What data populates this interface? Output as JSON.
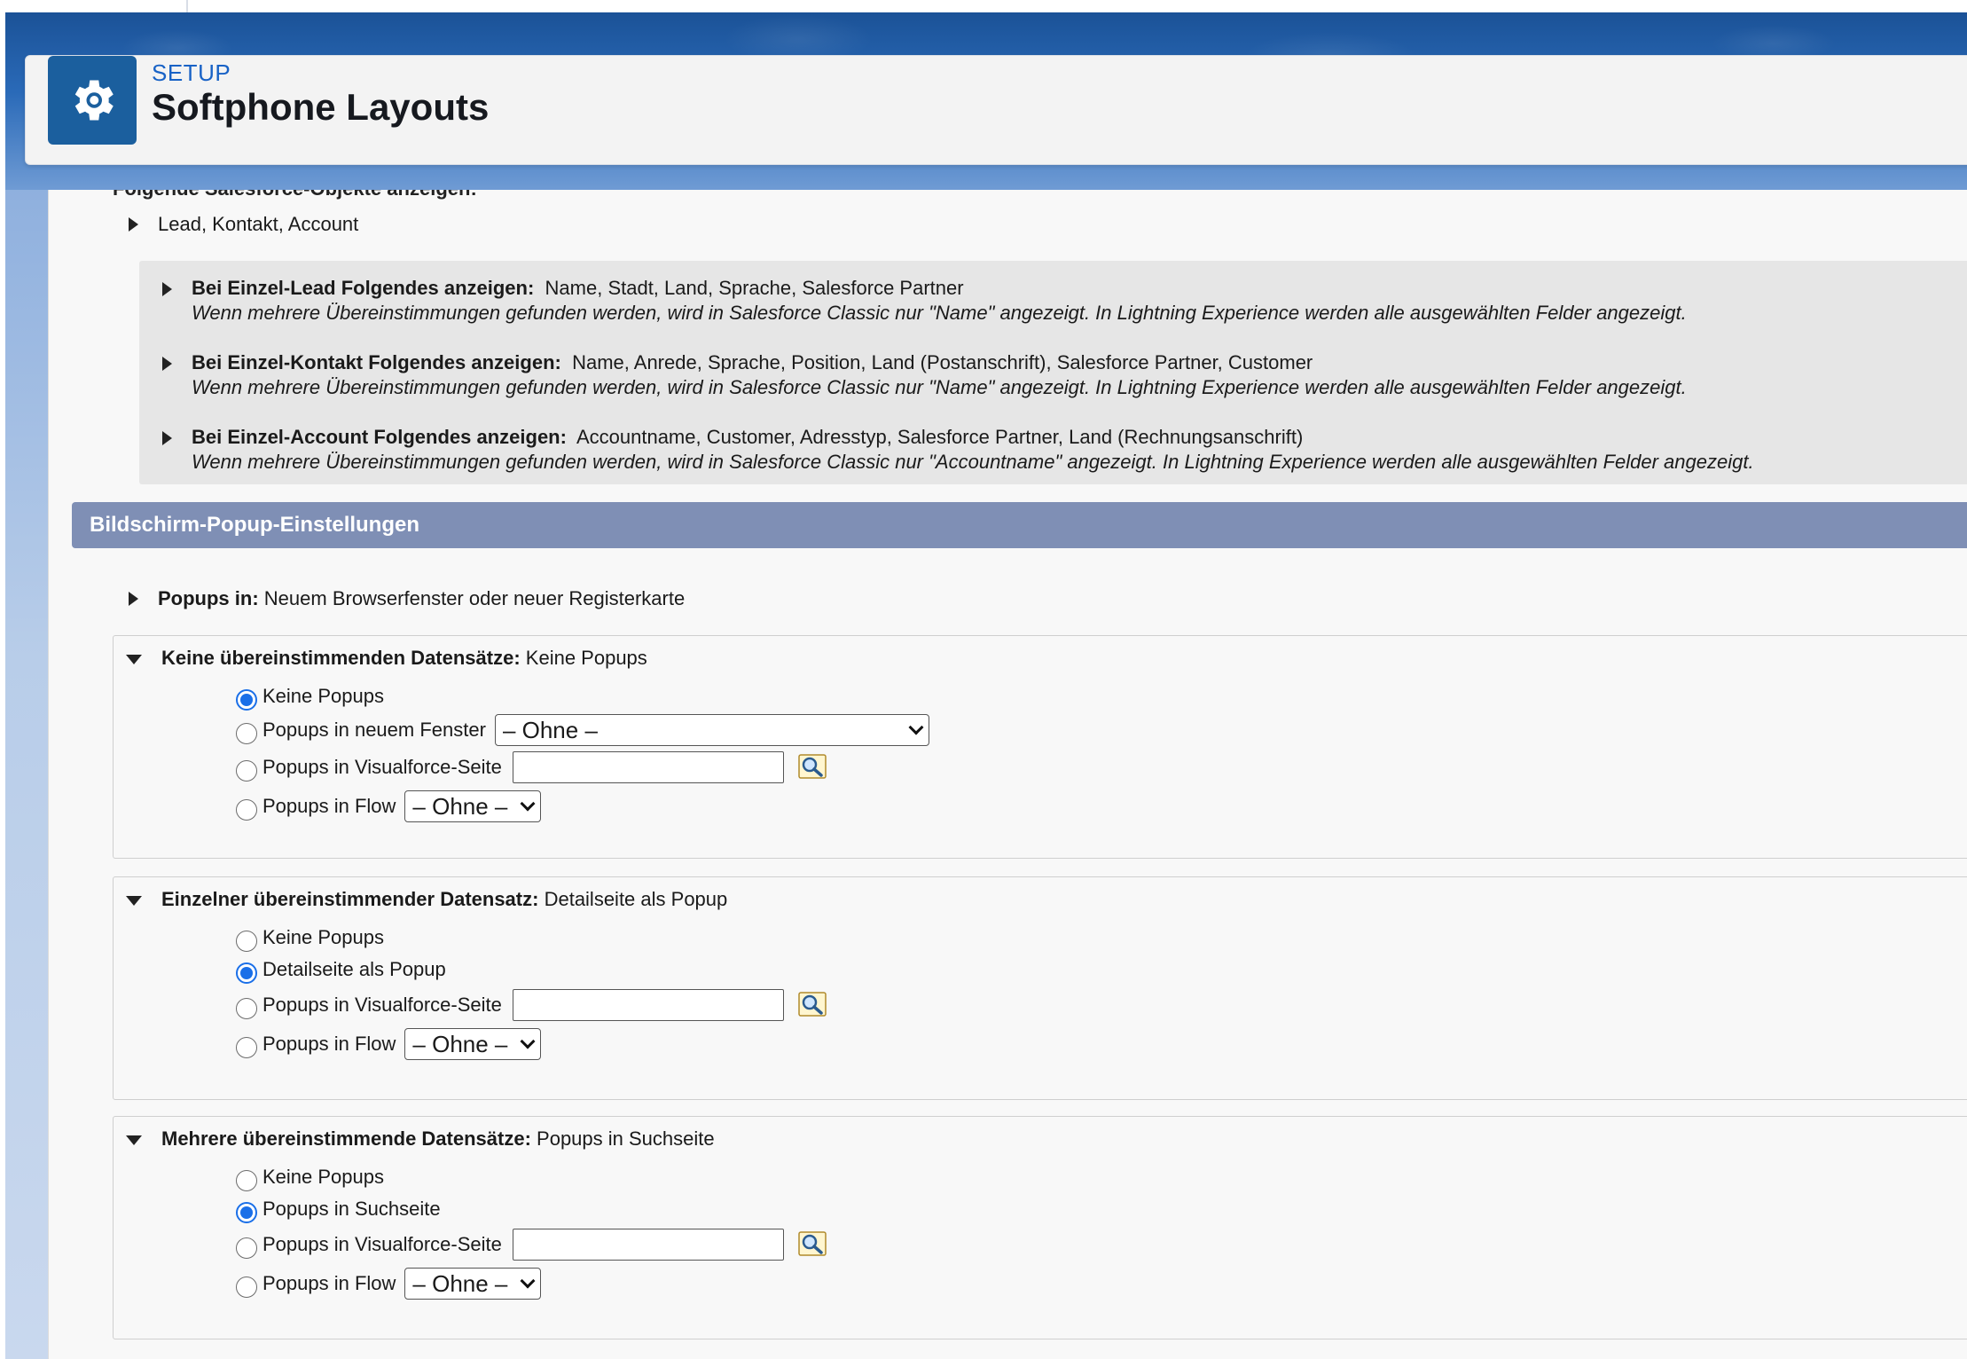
{
  "header": {
    "breadcrumb": "SETUP",
    "title": "Softphone Layouts"
  },
  "objects_section": {
    "cut_label": "Folgende Salesforce-Objekte anzeigen:",
    "objects": "Lead, Kontakt, Account",
    "details": [
      {
        "label": "Bei Einzel-Lead Folgendes anzeigen:",
        "fields": "Name, Stadt, Land, Sprache, Salesforce Partner",
        "note": "Wenn mehrere Übereinstimmungen gefunden werden, wird in Salesforce Classic nur \"Name\" angezeigt. In Lightning Experience werden alle ausgewählten Felder angezeigt."
      },
      {
        "label": "Bei Einzel-Kontakt Folgendes anzeigen:",
        "fields": "Name, Anrede, Sprache, Position, Land (Postanschrift), Salesforce Partner, Customer",
        "note": "Wenn mehrere Übereinstimmungen gefunden werden, wird in Salesforce Classic nur \"Name\" angezeigt. In Lightning Experience werden alle ausgewählten Felder angezeigt."
      },
      {
        "label": "Bei Einzel-Account Folgendes anzeigen:",
        "fields": "Accountname, Customer, Adresstyp, Salesforce Partner, Land (Rechnungsanschrift)",
        "note": "Wenn mehrere Übereinstimmungen gefunden werden, wird in Salesforce Classic nur \"Accountname\" angezeigt. In Lightning Experience werden alle ausgewählten Felder angezeigt."
      }
    ]
  },
  "popup_settings": {
    "section_title": "Bildschirm-Popup-Einstellungen",
    "popups_in_label": "Popups in:",
    "popups_in_value": "Neuem Browserfenster oder neuer Registerkarte",
    "groups": [
      {
        "label": "Keine übereinstimmenden Datensätze:",
        "value": "Keine Popups",
        "options": {
          "none": "Keine Popups",
          "window": "Popups in neuem Fenster",
          "visualforce": "Popups in Visualforce-Seite",
          "flow": "Popups in Flow"
        },
        "window_select": "– Ohne –",
        "flow_select": "– Ohne –"
      },
      {
        "label": "Einzelner übereinstimmender Datensatz:",
        "value": "Detailseite als Popup",
        "options": {
          "none": "Keine Popups",
          "detail": "Detailseite als Popup",
          "visualforce": "Popups in Visualforce-Seite",
          "flow": "Popups in Flow"
        },
        "flow_select": "– Ohne –"
      },
      {
        "label": "Mehrere übereinstimmende Datensätze:",
        "value": "Popups in Suchseite",
        "options": {
          "none": "Keine Popups",
          "search": "Popups in Suchseite",
          "visualforce": "Popups in Visualforce-Seite",
          "flow": "Popups in Flow"
        },
        "flow_select": "– Ohne –"
      }
    ]
  },
  "colors": {
    "brand_blue": "#1b5f9e",
    "section_header": "#7f8fb5",
    "radio_selected": "#1a6fe8",
    "link_blue": "#1862c6"
  }
}
